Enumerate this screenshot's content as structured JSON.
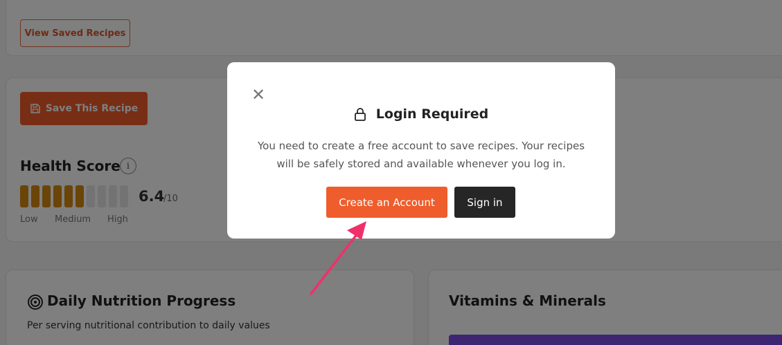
{
  "saved_section": {
    "view_saved_label": "View Saved Recipes"
  },
  "recipe_actions": {
    "save_label": "Save This Recipe"
  },
  "health_score": {
    "title": "Health Score",
    "info_glyph": "i",
    "value": "6.4",
    "max": "/10",
    "filled_segments": 6,
    "total_segments": 10,
    "scale_labels": {
      "low": "Low",
      "medium": "Medium",
      "high": "High"
    },
    "filled_color": "#d68910",
    "empty_color": "#e6e6e6"
  },
  "nutrition": {
    "title": "Daily Nutrition Progress",
    "subtitle": "Per serving nutritional contribution to daily values",
    "icon": "target-icon"
  },
  "vitamins": {
    "title": "Vitamins & Minerals",
    "accent": "#7b4be3"
  },
  "modal": {
    "close_glyph": "✕",
    "title": "Login Required",
    "icon": "lock-icon",
    "message": "You need to create a free account to save recipes. Your recipes will be safely stored and available whenever you log in.",
    "create_label": "Create an Account",
    "signin_label": "Sign in"
  },
  "colors": {
    "brand": "#ee5d2b",
    "annotation_arrow": "#f0306a"
  }
}
